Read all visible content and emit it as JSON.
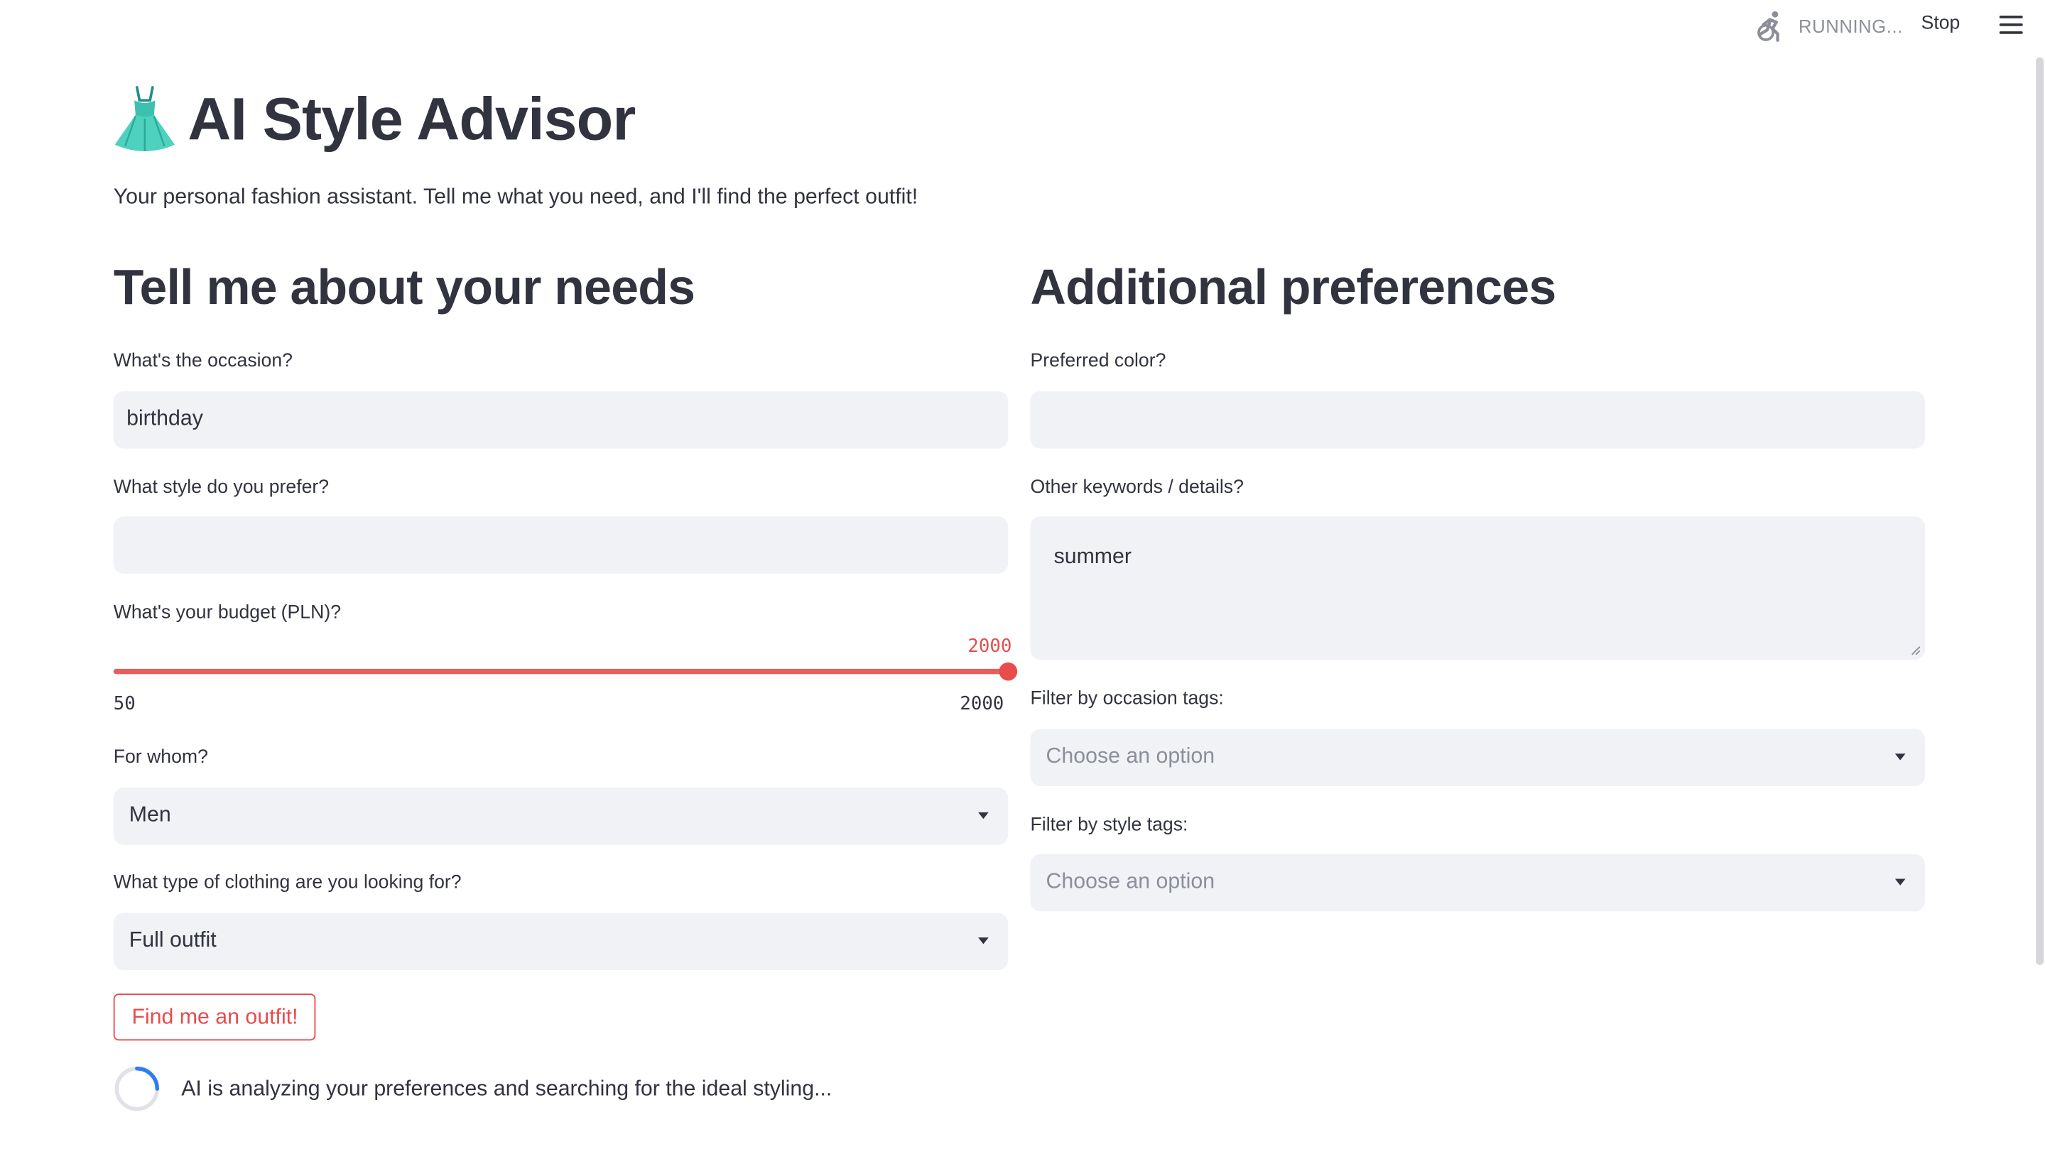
{
  "header": {
    "status": "RUNNING...",
    "stop_label": "Stop"
  },
  "icons": {
    "status": "running-person-icon",
    "menu": "hamburger-menu-icon",
    "title": "dress-emoji-icon",
    "spinner": "loading-spinner-icon"
  },
  "colors": {
    "accent": "#e84c4c",
    "field_bg": "#f0f2f6",
    "text": "#31333f",
    "muted": "#8c8f99"
  },
  "app": {
    "title": "AI Style Advisor",
    "subtitle": "Your personal fashion assistant. Tell me what you need, and I'll find the perfect outfit!"
  },
  "needs": {
    "heading": "Tell me about your needs",
    "occasion": {
      "label": "What's the occasion?",
      "value": "birthday"
    },
    "style": {
      "label": "What style do you prefer?",
      "value": ""
    },
    "budget": {
      "label": "What's your budget (PLN)?",
      "value": 2000,
      "value_text": "2000",
      "min": 50,
      "max": 2000,
      "min_text": "50",
      "max_text": "2000"
    },
    "for_whom": {
      "label": "For whom?",
      "value": "Men"
    },
    "clothing_type": {
      "label": "What type of clothing are you looking for?",
      "value": "Full outfit"
    },
    "submit_label": "Find me an outfit!"
  },
  "preferences": {
    "heading": "Additional preferences",
    "color": {
      "label": "Preferred color?",
      "value": ""
    },
    "keywords": {
      "label": "Other keywords / details?",
      "value": "summer"
    },
    "occasion_tags": {
      "label": "Filter by occasion tags:",
      "placeholder": "Choose an option"
    },
    "style_tags": {
      "label": "Filter by style tags:",
      "placeholder": "Choose an option"
    }
  },
  "loading": {
    "message": "AI is analyzing your preferences and searching for the ideal styling..."
  }
}
